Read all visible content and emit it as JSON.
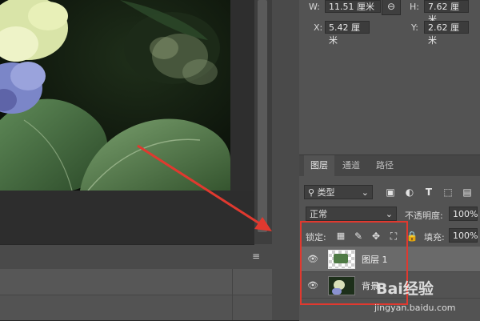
{
  "properties": {
    "w_label": "W:",
    "w_value": "11.51 厘米",
    "h_label": "H:",
    "h_value": "7.62 厘米",
    "x_label": "X:",
    "x_value": "5.42 厘米",
    "y_label": "Y:",
    "y_value": "2.62 厘米"
  },
  "layers_panel": {
    "tabs": [
      {
        "label": "图层",
        "active": true
      },
      {
        "label": "通道",
        "active": false
      },
      {
        "label": "路径",
        "active": false
      }
    ],
    "filter_kind": "类型",
    "blend_mode": "正常",
    "opacity_label": "不透明度:",
    "opacity_value": "100%",
    "lock_label": "锁定:",
    "fill_label": "填充:",
    "fill_value": "100%",
    "layers": [
      {
        "name": "图层 1",
        "selected": true
      },
      {
        "name": "背景",
        "selected": false
      }
    ]
  },
  "watermark": {
    "brand": "Bai经验",
    "url": "jingyan.baidu.com"
  },
  "colors": {
    "annotation_red": "#e0392f",
    "panel_bg": "#535353",
    "canvas_bg": "#282828"
  }
}
